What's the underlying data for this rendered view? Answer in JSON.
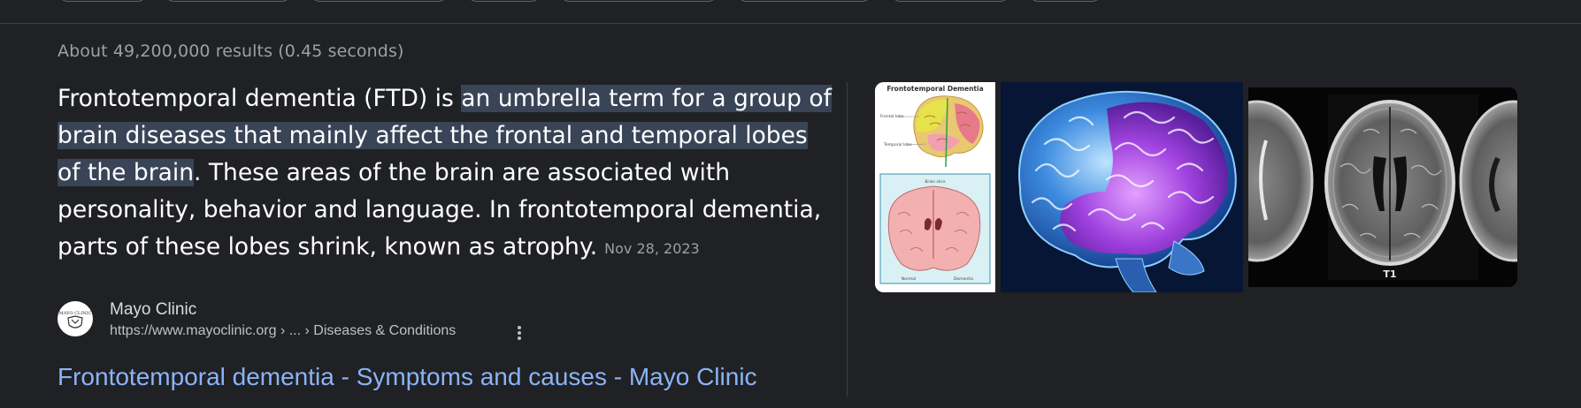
{
  "results_stats": "About 49,200,000 results (0.45 seconds)",
  "snippet": {
    "lead": "Frontotemporal dementia (FTD) is ",
    "highlight": "an umbrella term for a group of brain diseases that mainly affect the frontal and temporal lobes of the brain",
    "rest": ". These areas of the brain are associated with personality, behavior and language. In frontotemporal dementia, parts of these lobes shrink, known as atrophy.",
    "date": "Nov 28, 2023"
  },
  "source": {
    "name": "Mayo Clinic",
    "url": "https://www.mayoclinic.org › ... › Diseases & Conditions",
    "favicon_text": "MAYO CLINIC"
  },
  "result_link": {
    "title": "Frontotemporal dementia - Symptoms and causes - Mayo Clinic"
  },
  "images": {
    "diagram_title": "Frontotemporal Dementia",
    "diagram_labels": [
      "Frontal lobe",
      "Temporal lobe",
      "Brain slice",
      "Normal",
      "Dementia"
    ],
    "mri_label": "T1"
  },
  "colors": {
    "background": "#202124",
    "snippet_text": "#ffffff",
    "highlight_bg": "#394457",
    "muted_text": "#9aa0a6",
    "link": "#8ab4f8"
  },
  "icons": [
    "more-vert-icon"
  ]
}
